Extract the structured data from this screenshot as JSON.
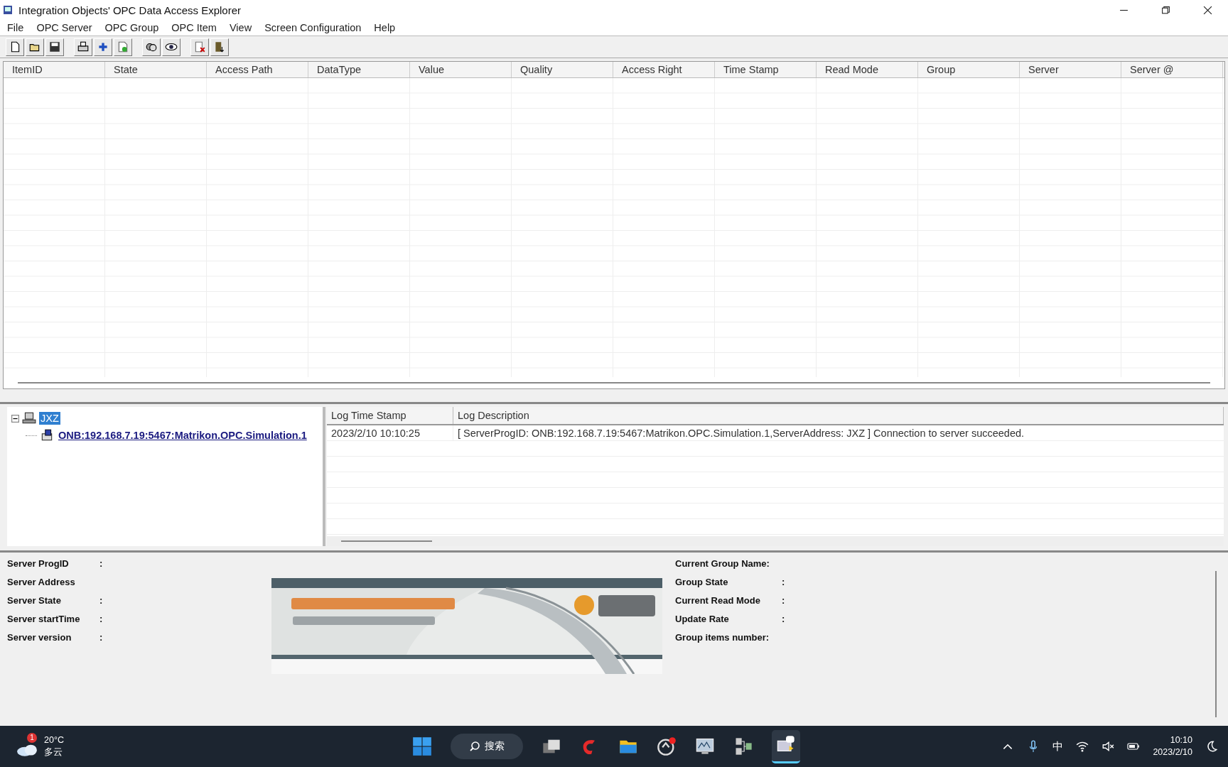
{
  "window": {
    "title": "Integration Objects' OPC Data Access Explorer"
  },
  "menu": [
    "File",
    "OPC Server",
    "OPC Group",
    "OPC Item",
    "View",
    "Screen Configuration",
    "Help"
  ],
  "table": {
    "columns": [
      "ItemID",
      "State",
      "Access Path",
      "DataType",
      "Value",
      "Quality",
      "Access Right",
      "Time Stamp",
      "Read Mode",
      "Group",
      "Server",
      "Server @"
    ]
  },
  "tree": [
    {
      "label": "JXZ",
      "selected": true,
      "expanded": true,
      "children": [
        {
          "label": "ONB:192.168.7.19:5467:Matrikon.OPC.Simulation.1",
          "selected": false
        }
      ]
    }
  ],
  "log": {
    "columns": [
      "Log Time Stamp",
      "Log Description"
    ],
    "rows": [
      {
        "time": "2023/2/10 10:10:25",
        "description": "[ ServerProgID: ONB:192.168.7.19:5467:Matrikon.OPC.Simulation.1,ServerAddress: JXZ ] Connection to server succeeded."
      }
    ]
  },
  "server_info": [
    {
      "label": "Server ProgID",
      "separator": ":"
    },
    {
      "label": "Server Address"
    },
    {
      "label": "Server State",
      "separator": ":"
    },
    {
      "label": "Server startTime",
      "separator": ":"
    },
    {
      "label": "Server version",
      "separator": ":"
    }
  ],
  "group_info": [
    {
      "label": "Current Group Name:"
    },
    {
      "label": "Group State",
      "separator": ":"
    },
    {
      "label": "Current Read Mode",
      "separator": ":"
    },
    {
      "label": "Update Rate",
      "separator": ":"
    },
    {
      "label": "Group items number:"
    }
  ],
  "taskbar": {
    "weather": {
      "badge": "1",
      "temperature": "20°C",
      "condition": "多云"
    },
    "search": "搜索",
    "input_language": "中",
    "clock": {
      "time": "10:10",
      "date": "2023/2/10"
    }
  }
}
